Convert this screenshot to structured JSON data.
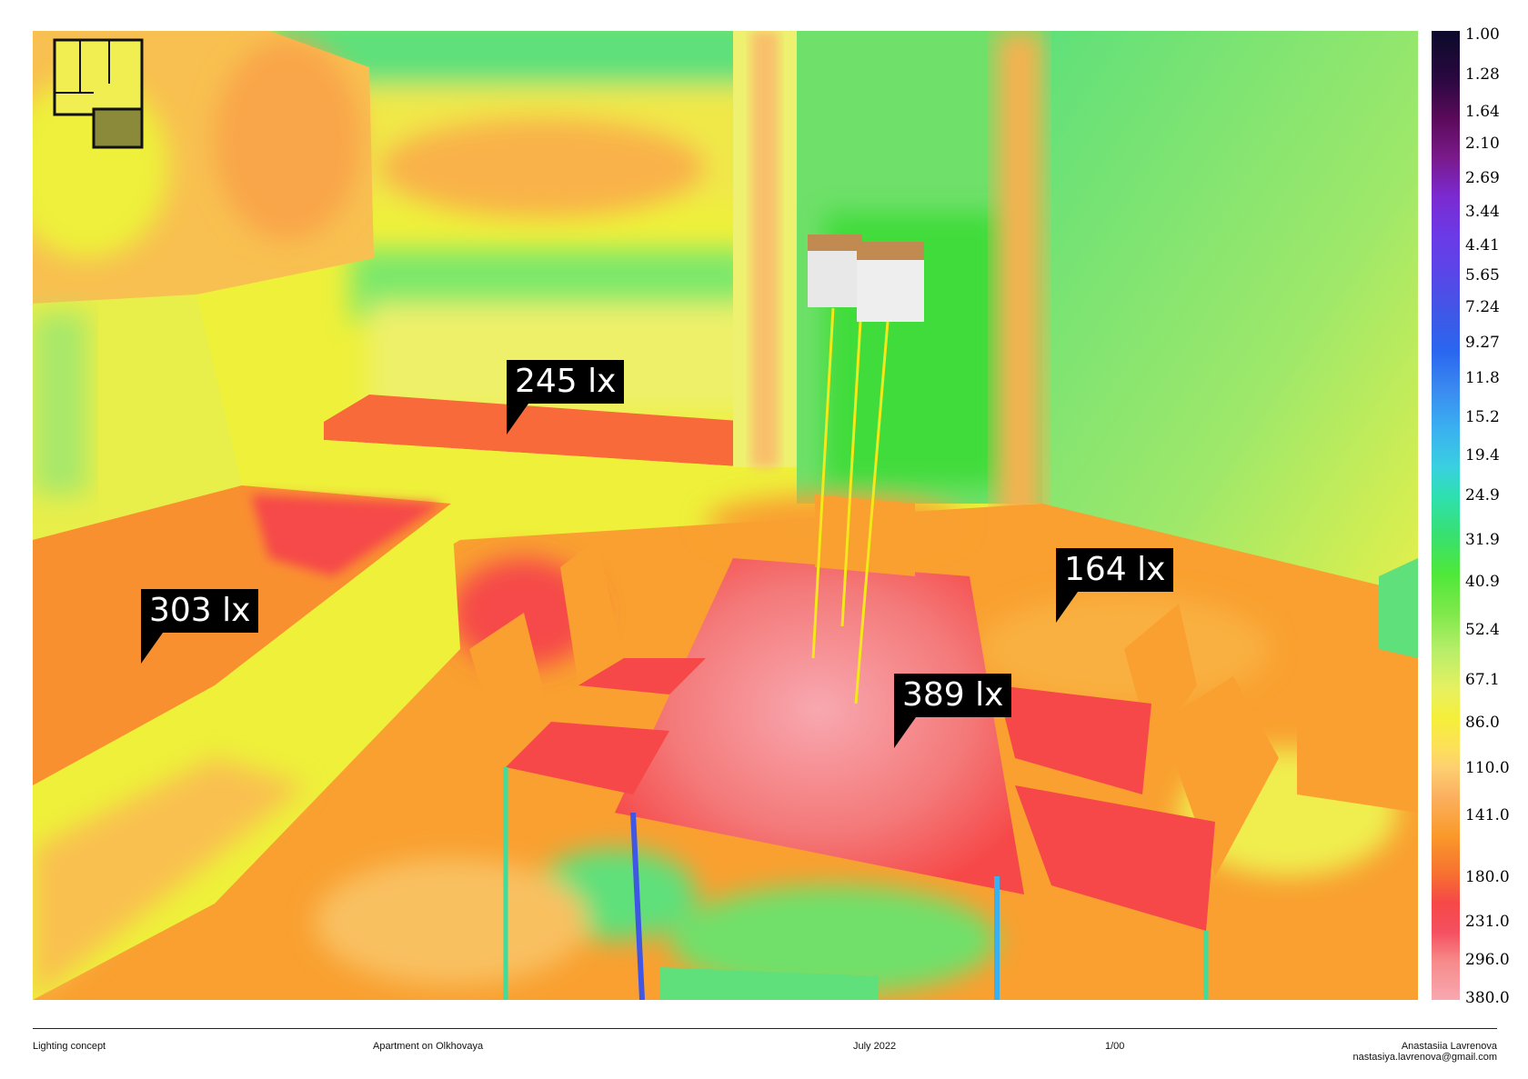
{
  "callouts": [
    {
      "label": "245 lx"
    },
    {
      "label": "303 lx"
    },
    {
      "label": "164 lx"
    },
    {
      "label": "389 lx"
    }
  ],
  "scale": {
    "ticks": [
      "1.00",
      "1.28",
      "1.64",
      "2.10",
      "2.69",
      "3.44",
      "4.41",
      "5.65",
      "7.24",
      "9.27",
      "11.8",
      "15.2",
      "19.4",
      "24.9",
      "31.9",
      "40.9",
      "52.4",
      "67.1",
      "86.0",
      "110.0",
      "141.0",
      "180.0",
      "231.0",
      "296.0",
      "380.0"
    ]
  },
  "footer": {
    "left": "Lighting concept",
    "project": "Apartment on Olkhovaya",
    "date": "July 2022",
    "sheet": "1/00",
    "author": "Anastasiia Lavrenova",
    "email": "nastasiya.lavrenova@gmail.com"
  },
  "colors": {
    "yellow": "#f3f33a",
    "orange": "#fa9a2a",
    "red": "#f64848",
    "pink": "#f5a0a0",
    "green": "#5fe07a",
    "brightgreen": "#3fdc3a"
  }
}
